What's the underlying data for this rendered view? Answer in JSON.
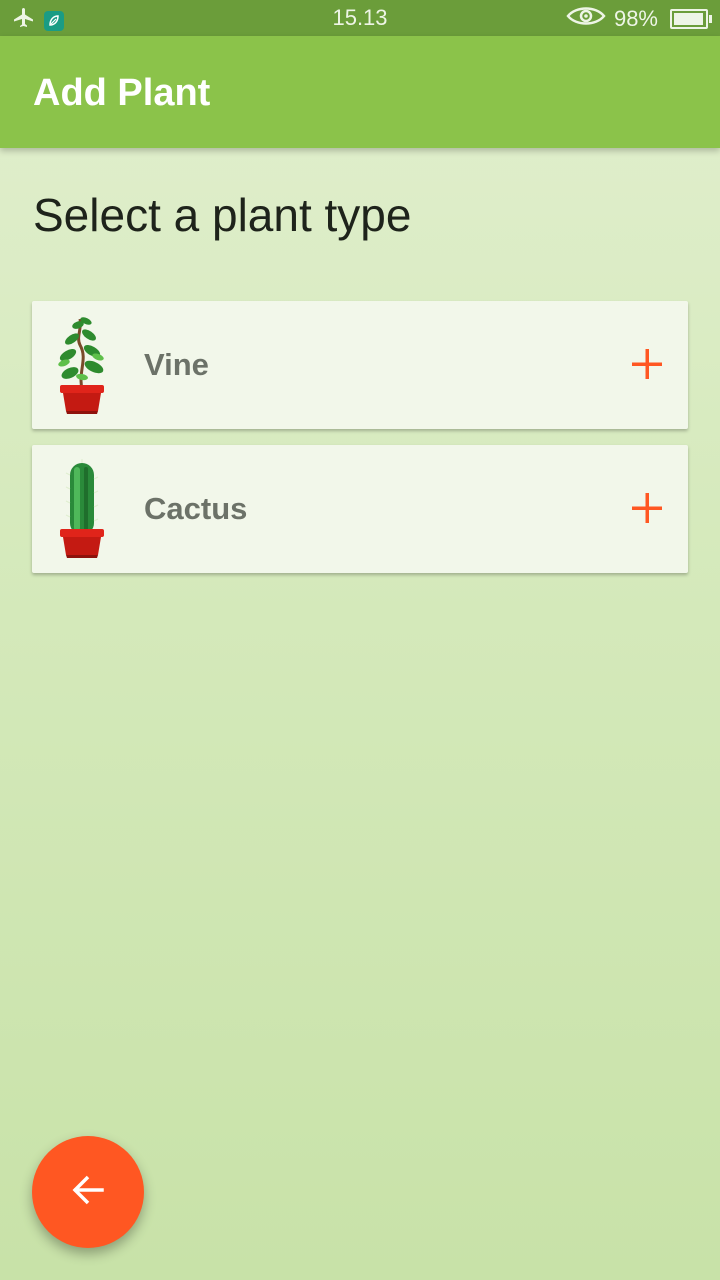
{
  "status_bar": {
    "time": "15.13",
    "battery_text": "98%",
    "battery_level": 0.98,
    "icons": [
      "airplane-icon",
      "app-notification-icon",
      "eye-icon",
      "battery-icon"
    ]
  },
  "app_bar": {
    "title": "Add Plant",
    "color": "#8bc34a"
  },
  "content": {
    "heading": "Select a plant type",
    "plant_types": [
      {
        "label": "Vine",
        "icon": "vine-plant-icon",
        "action_icon": "add-icon"
      },
      {
        "label": "Cactus",
        "icon": "cactus-plant-icon",
        "action_icon": "add-icon"
      }
    ]
  },
  "fab": {
    "icon": "back-arrow-icon",
    "color": "#ff5722"
  },
  "colors": {
    "accent": "#ff5722",
    "primary": "#8bc34a",
    "status_bar": "#6b9d3a"
  }
}
